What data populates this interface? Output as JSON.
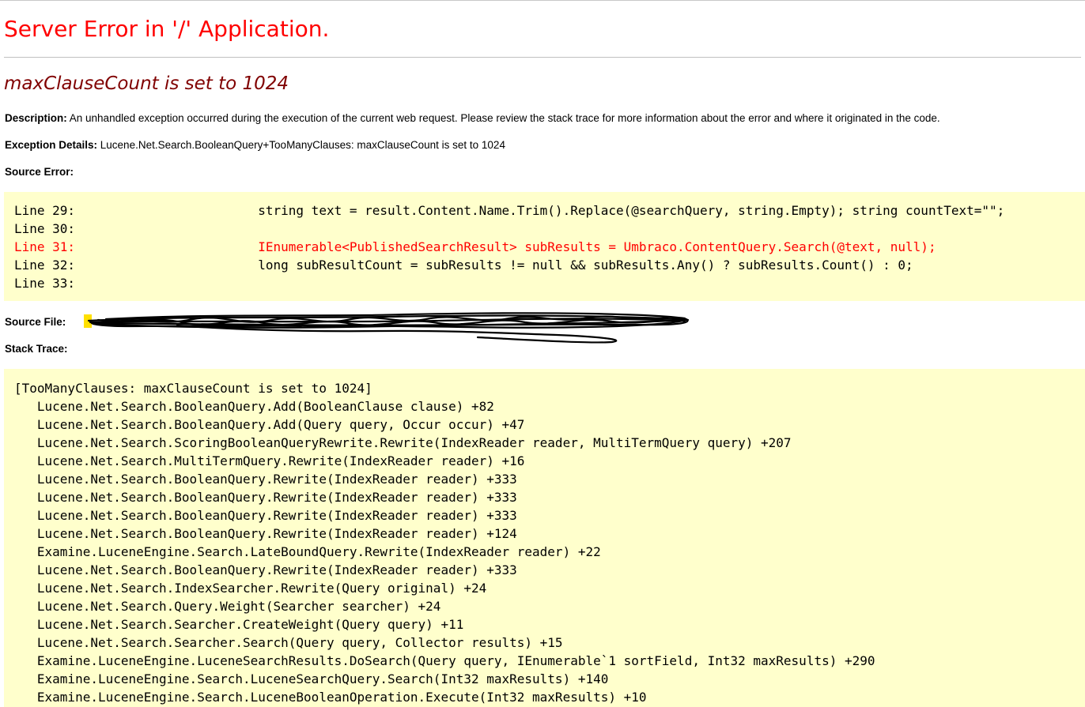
{
  "page": {
    "title": "Server Error in '/' Application.",
    "error_message": "maxClauseCount is set to 1024"
  },
  "description": {
    "label": "Description:",
    "text": " An unhandled exception occurred during the execution of the current web request. Please review the stack trace for more information about the error and where it originated in the code."
  },
  "exception_details": {
    "label": "Exception Details:",
    "text": " Lucene.Net.Search.BooleanQuery+TooManyClauses: maxClauseCount is set to 1024"
  },
  "source_error": {
    "label": "Source Error:",
    "lines": [
      {
        "text": "Line 29:                        string text = result.Content.Name.Trim().Replace(@searchQuery, string.Empty); string countText=\"\";",
        "is_error": false
      },
      {
        "text": "Line 30:",
        "is_error": false
      },
      {
        "text": "Line 31:                        IEnumerable<PublishedSearchResult> subResults = Umbraco.ContentQuery.Search(@text, null);",
        "is_error": true
      },
      {
        "text": "Line 32:                        long subResultCount = subResults != null && subResults.Any() ? subResults.Count() : 0;",
        "is_error": false
      },
      {
        "text": "Line 33:",
        "is_error": false
      }
    ]
  },
  "source_file": {
    "label": "Source File:",
    "redaction_color": "#000000",
    "marker_color": "#ffe000"
  },
  "stack_trace": {
    "label": "Stack Trace:",
    "lines": [
      "[TooManyClauses: maxClauseCount is set to 1024]",
      "   Lucene.Net.Search.BooleanQuery.Add(BooleanClause clause) +82",
      "   Lucene.Net.Search.BooleanQuery.Add(Query query, Occur occur) +47",
      "   Lucene.Net.Search.ScoringBooleanQueryRewrite.Rewrite(IndexReader reader, MultiTermQuery query) +207",
      "   Lucene.Net.Search.MultiTermQuery.Rewrite(IndexReader reader) +16",
      "   Lucene.Net.Search.BooleanQuery.Rewrite(IndexReader reader) +333",
      "   Lucene.Net.Search.BooleanQuery.Rewrite(IndexReader reader) +333",
      "   Lucene.Net.Search.BooleanQuery.Rewrite(IndexReader reader) +333",
      "   Lucene.Net.Search.BooleanQuery.Rewrite(IndexReader reader) +124",
      "   Examine.LuceneEngine.Search.LateBoundQuery.Rewrite(IndexReader reader) +22",
      "   Lucene.Net.Search.BooleanQuery.Rewrite(IndexReader reader) +333",
      "   Lucene.Net.Search.IndexSearcher.Rewrite(Query original) +24",
      "   Lucene.Net.Search.Query.Weight(Searcher searcher) +24",
      "   Lucene.Net.Search.Searcher.CreateWeight(Query query) +11",
      "   Lucene.Net.Search.Searcher.Search(Query query, Collector results) +15",
      "   Examine.LuceneEngine.LuceneSearchResults.DoSearch(Query query, IEnumerable`1 sortField, Int32 maxResults) +290",
      "   Examine.LuceneEngine.Search.LuceneSearchQuery.Search(Int32 maxResults) +140",
      "   Examine.LuceneEngine.Search.LuceneBooleanOperation.Execute(Int32 maxResults) +10"
    ]
  },
  "colors": {
    "title": "#ff0000",
    "error_message": "#800000",
    "code_background": "#ffffcc",
    "error_line": "#ff0000"
  }
}
